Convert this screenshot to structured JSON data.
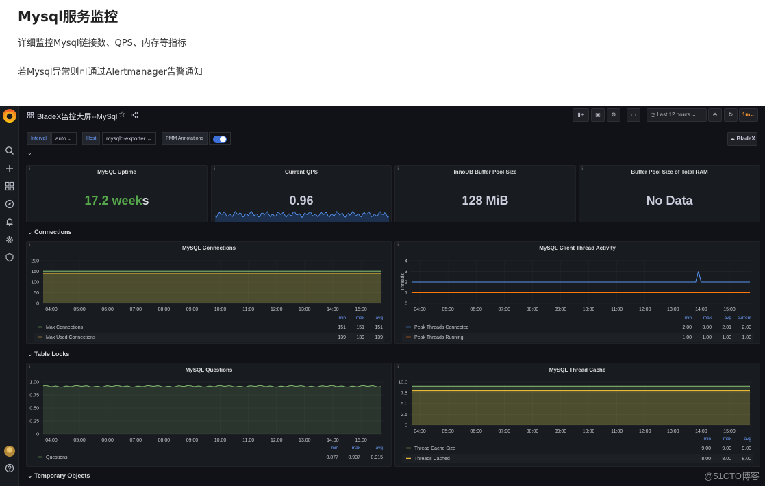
{
  "article": {
    "title": "Mysql服务监控",
    "line1": "详细监控Mysql链接数、QPS、内存等指标",
    "line2": "若Mysql异常则可通过Alertmanager告警通知"
  },
  "topbar": {
    "dashboard_title": "BladeX监控大屏--MySql",
    "time_range": "Last 12 hours",
    "refresh": "1m",
    "org": "BladeX"
  },
  "variables": {
    "interval_label": "Interval",
    "interval_value": "auto",
    "host_label": "Host",
    "host_value": "mysqld-exporter",
    "annotations_label": "PMM Annotations"
  },
  "stats": [
    {
      "title": "MySQL Uptime",
      "value": "17.2 weeks",
      "color": "#56a64b"
    },
    {
      "title": "Current QPS",
      "value": "0.96",
      "color": "#d8d9da"
    },
    {
      "title": "InnoDB Buffer Pool Size",
      "value": "128 MiB",
      "color": "#d8d9da"
    },
    {
      "title": "Buffer Pool Size of Total RAM",
      "value": "No Data",
      "color": "#d8d9da"
    }
  ],
  "rows": {
    "connections": "Connections",
    "table_locks": "Table Locks",
    "temporary_objects": "Temporary Objects"
  },
  "time_ticks": [
    "04:00",
    "05:00",
    "06:00",
    "07:00",
    "08:00",
    "09:00",
    "10:00",
    "11:00",
    "12:00",
    "13:00",
    "14:00",
    "15:00"
  ],
  "panels": {
    "connections": {
      "title": "MySQL Connections",
      "y_ticks": [
        "200",
        "150",
        "100",
        "50",
        "0"
      ],
      "legend_headers": [
        "min",
        "max",
        "avg"
      ],
      "series": [
        {
          "name": "Max Connections",
          "color": "#7eb26d",
          "values": [
            "151",
            "151",
            "151"
          ]
        },
        {
          "name": "Max Used Connections",
          "color": "#eab839",
          "values": [
            "139",
            "139",
            "139"
          ]
        }
      ]
    },
    "threads": {
      "title": "MySQL Client Thread Activity",
      "ylabel": "Threads",
      "y_ticks": [
        "4",
        "3",
        "2",
        "1",
        "0"
      ],
      "legend_headers": [
        "min",
        "max",
        "avg",
        "current"
      ],
      "series": [
        {
          "name": "Peak Threads Connected",
          "color": "#5794f2",
          "values": [
            "2.00",
            "3.00",
            "2.01",
            "2.00"
          ]
        },
        {
          "name": "Peak Threads Running",
          "color": "#ff780a",
          "values": [
            "1.00",
            "1.00",
            "1.00",
            "1.00"
          ]
        }
      ]
    },
    "questions": {
      "title": "MySQL Questions",
      "y_ticks": [
        "1.00",
        "0.75",
        "0.50",
        "0.25",
        "0"
      ],
      "legend_headers": [
        "min",
        "max",
        "avg"
      ],
      "series": [
        {
          "name": "Questions",
          "color": "#7eb26d",
          "values": [
            "0.877",
            "0.937",
            "0.915"
          ]
        }
      ]
    },
    "thread_cache": {
      "title": "MySQL Thread Cache",
      "y_ticks": [
        "10.0",
        "7.5",
        "5.0",
        "2.5",
        "0"
      ],
      "legend_headers": [
        "min",
        "max",
        "avg"
      ],
      "series": [
        {
          "name": "Thread Cache Size",
          "color": "#7eb26d",
          "values": [
            "9.00",
            "9.00",
            "9.00"
          ]
        },
        {
          "name": "Threads Cached",
          "color": "#eab839",
          "values": [
            "8.00",
            "8.00",
            "8.00"
          ]
        }
      ]
    }
  },
  "chart_data": [
    {
      "type": "line",
      "title": "MySQL Connections",
      "x": [
        "04:00",
        "05:00",
        "06:00",
        "07:00",
        "08:00",
        "09:00",
        "10:00",
        "11:00",
        "12:00",
        "13:00",
        "14:00",
        "15:00"
      ],
      "ylim": [
        0,
        200
      ],
      "series": [
        {
          "name": "Max Connections",
          "values": [
            151,
            151,
            151,
            151,
            151,
            151,
            151,
            151,
            151,
            151,
            151,
            151
          ]
        },
        {
          "name": "Max Used Connections",
          "values": [
            139,
            139,
            139,
            139,
            139,
            139,
            139,
            139,
            139,
            139,
            139,
            139
          ]
        }
      ]
    },
    {
      "type": "line",
      "title": "MySQL Client Thread Activity",
      "ylabel": "Threads",
      "x": [
        "04:00",
        "05:00",
        "06:00",
        "07:00",
        "08:00",
        "09:00",
        "10:00",
        "11:00",
        "12:00",
        "13:00",
        "14:00",
        "15:00"
      ],
      "ylim": [
        0,
        4
      ],
      "series": [
        {
          "name": "Peak Threads Connected",
          "values": [
            2,
            2,
            2,
            2,
            2,
            2,
            2,
            2,
            2,
            2,
            3,
            2
          ]
        },
        {
          "name": "Peak Threads Running",
          "values": [
            1,
            1,
            1,
            1,
            1,
            1,
            1,
            1,
            1,
            1,
            1,
            1
          ]
        }
      ]
    },
    {
      "type": "area",
      "title": "MySQL Questions",
      "x": [
        "04:00",
        "05:00",
        "06:00",
        "07:00",
        "08:00",
        "09:00",
        "10:00",
        "11:00",
        "12:00",
        "13:00",
        "14:00",
        "15:00"
      ],
      "ylim": [
        0,
        1
      ],
      "series": [
        {
          "name": "Questions",
          "values": [
            0.92,
            0.91,
            0.92,
            0.91,
            0.92,
            0.91,
            0.92,
            0.9,
            0.92,
            0.91,
            0.92,
            0.91
          ]
        }
      ]
    },
    {
      "type": "area",
      "title": "MySQL Thread Cache",
      "x": [
        "04:00",
        "05:00",
        "06:00",
        "07:00",
        "08:00",
        "09:00",
        "10:00",
        "11:00",
        "12:00",
        "13:00",
        "14:00",
        "15:00"
      ],
      "ylim": [
        0,
        10
      ],
      "series": [
        {
          "name": "Thread Cache Size",
          "values": [
            9,
            9,
            9,
            9,
            9,
            9,
            9,
            9,
            9,
            9,
            9,
            9
          ]
        },
        {
          "name": "Threads Cached",
          "values": [
            8,
            8,
            8,
            8,
            8,
            8,
            8,
            8,
            8,
            8,
            8,
            8
          ]
        }
      ]
    }
  ],
  "watermark": "@51CTO博客"
}
